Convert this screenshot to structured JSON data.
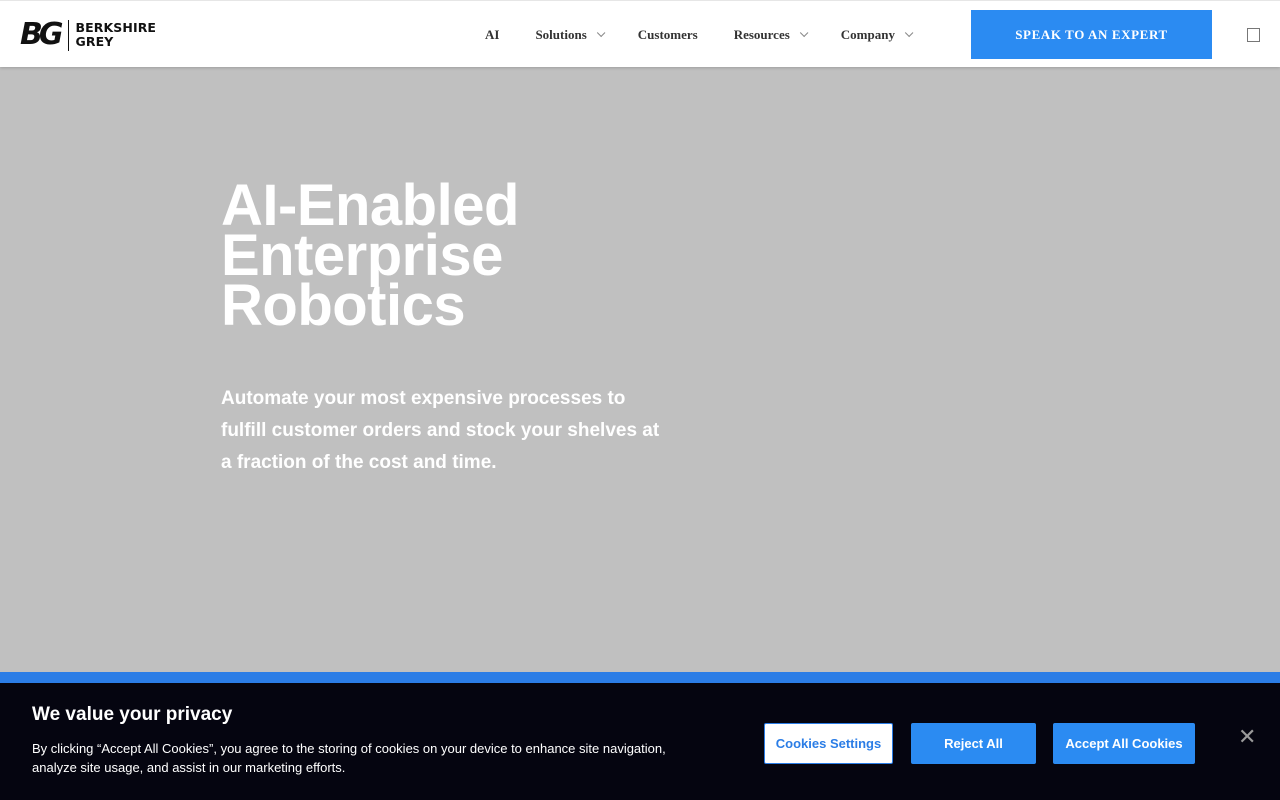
{
  "header": {
    "logo": {
      "mark": "BG",
      "line1": "BERKSHIRE",
      "line2": "GREY"
    },
    "nav": [
      {
        "label": "AI",
        "dropdown": false
      },
      {
        "label": "Solutions",
        "dropdown": true
      },
      {
        "label": "Customers",
        "dropdown": false
      },
      {
        "label": "Resources",
        "dropdown": true
      },
      {
        "label": "Company",
        "dropdown": true
      }
    ],
    "cta_label": "SPEAK TO AN EXPERT"
  },
  "hero": {
    "title_lines": [
      "AI-Enabled",
      "Enterprise",
      "Robotics"
    ],
    "subtitle": "Automate your most expensive processes to fulfill customer orders and stock your shelves at a fraction of the cost and time."
  },
  "cookie_banner": {
    "title": "We value your privacy",
    "text": "By clicking “Accept All Cookies”, you agree to the storing of cookies on your device to enhance site navigation, analyze site usage, and assist in our marketing efforts.",
    "settings_label": "Cookies Settings",
    "reject_label": "Reject All",
    "accept_label": "Accept All Cookies",
    "close_glyph": "✕"
  },
  "colors": {
    "accent": "#2b8bf2",
    "strip": "#2b7de6",
    "hero_bg": "#c0c0c0",
    "banner_bg": "#050510"
  }
}
